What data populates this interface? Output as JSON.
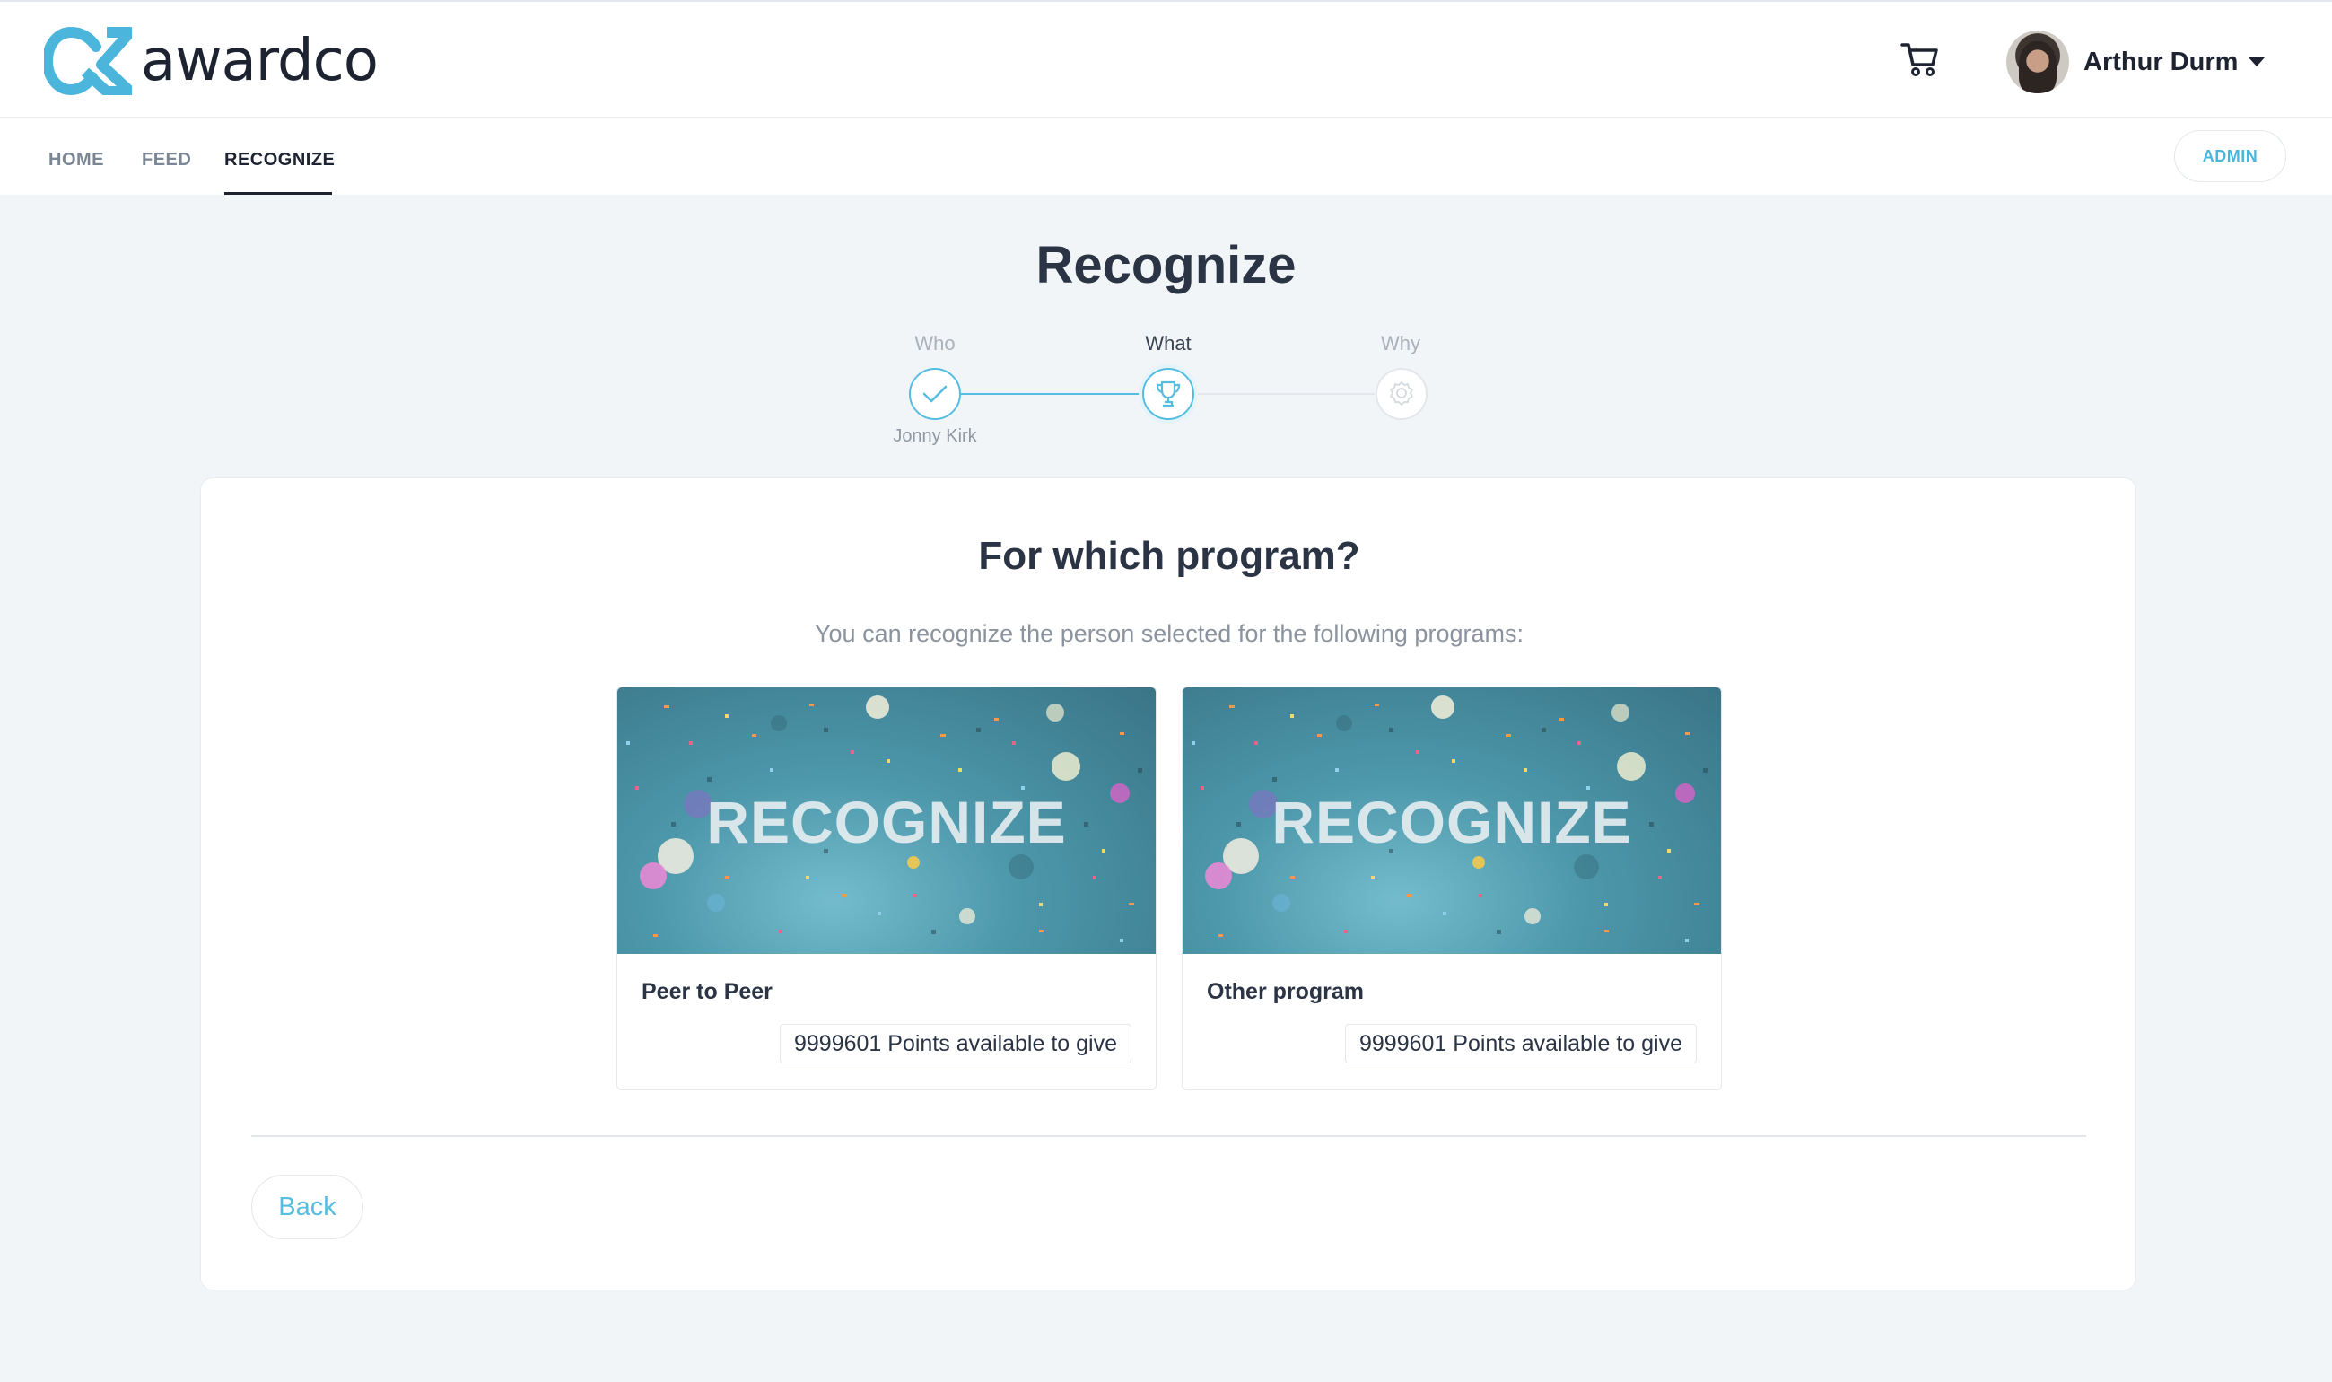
{
  "header": {
    "logo_text": "awardco",
    "user_name": "Arthur Durm",
    "brand_color": "#4bb5dc"
  },
  "nav": {
    "items": [
      {
        "label": "HOME",
        "active": false
      },
      {
        "label": "FEED",
        "active": false
      },
      {
        "label": "RECOGNIZE",
        "active": true
      }
    ],
    "admin_label": "ADMIN"
  },
  "page": {
    "title": "Recognize"
  },
  "stepper": {
    "steps": [
      {
        "label": "Who",
        "sublabel": "Jonny Kirk",
        "state": "done",
        "icon": "check-icon"
      },
      {
        "label": "What",
        "sublabel": "",
        "state": "current",
        "icon": "trophy-icon"
      },
      {
        "label": "Why",
        "sublabel": "",
        "state": "future",
        "icon": "badge-icon"
      }
    ]
  },
  "card": {
    "title": "For which program?",
    "subtitle": "You can recognize the person selected for the following programs:",
    "programs": [
      {
        "image_text": "RECOGNIZE",
        "name": "Peer to Peer",
        "points": "9999601 Points available to give"
      },
      {
        "image_text": "RECOGNIZE",
        "name": "Other program",
        "points": "9999601 Points available to give"
      }
    ],
    "back_label": "Back"
  }
}
